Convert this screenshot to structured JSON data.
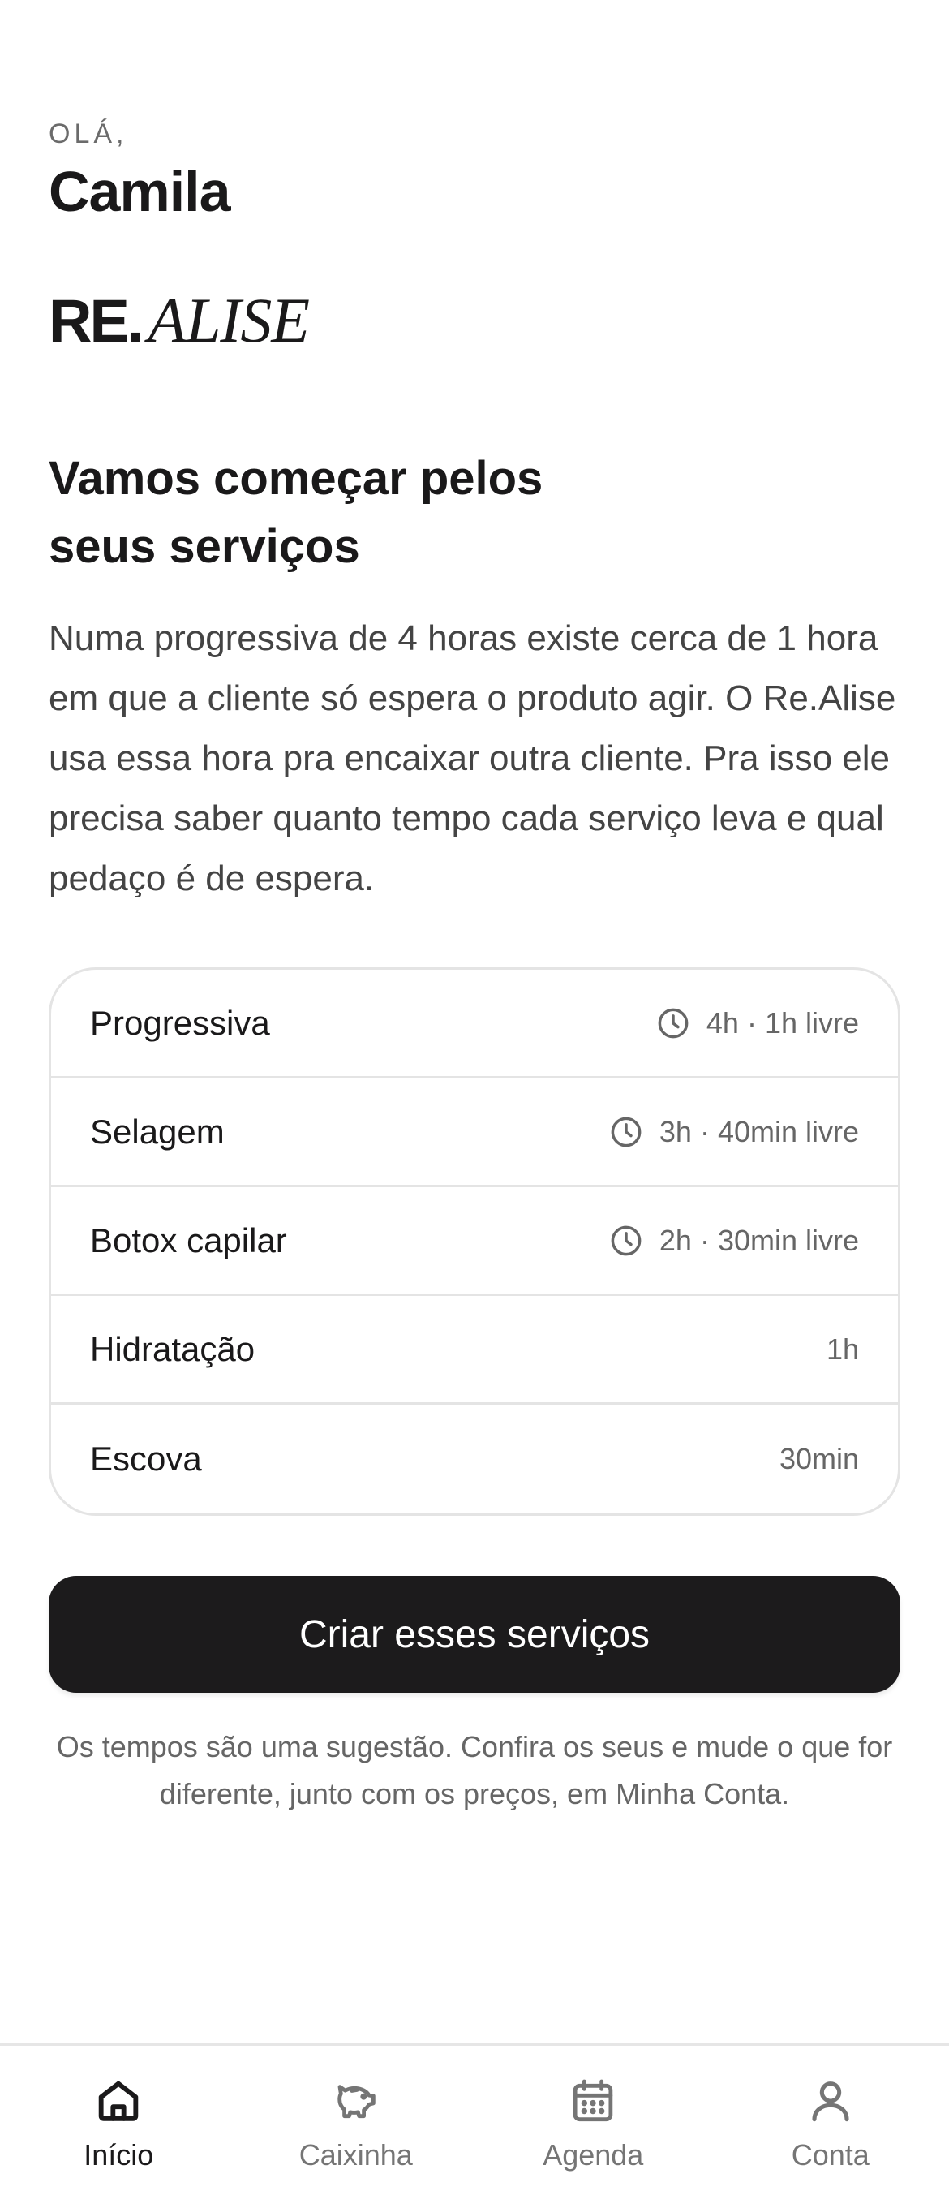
{
  "greeting": {
    "label": "OLÁ,",
    "name": "Camila"
  },
  "brand": {
    "logo_bold": "RE.",
    "logo_italic": "ALISE"
  },
  "intro": {
    "title": "Vamos começar pelos seus serviços",
    "description": "Numa progressiva de 4 horas existe cerca de 1 hora em que a cliente só espera o produto agir. O Re.Alise usa essa hora pra encaixar outra cliente. Pra isso ele precisa saber quanto tempo cada serviço leva e qual pedaço é de espera."
  },
  "services": [
    {
      "name": "Progressiva",
      "duration": "4h · 1h livre",
      "icon": "clock-icon"
    },
    {
      "name": "Selagem",
      "duration": "3h · 40min livre",
      "icon": "clock-icon"
    },
    {
      "name": "Botox capilar",
      "duration": "2h · 30min livre",
      "icon": "clock-icon"
    },
    {
      "name": "Hidratação",
      "duration": "1h",
      "icon": ""
    },
    {
      "name": "Escova",
      "duration": "30min",
      "icon": ""
    }
  ],
  "cta": {
    "label": "Criar esses serviços"
  },
  "footnote": "Os tempos são uma sugestão. Confira os seus e mude o que for diferente, junto com os preços, em Minha Conta.",
  "nav": {
    "items": [
      {
        "label": "Início",
        "icon": "home-icon",
        "active": true
      },
      {
        "label": "Caixinha",
        "icon": "piggy-bank-icon",
        "active": false
      },
      {
        "label": "Agenda",
        "icon": "calendar-icon",
        "active": false
      },
      {
        "label": "Conta",
        "icon": "user-icon",
        "active": false
      }
    ]
  },
  "colors": {
    "primary": "#1c1b1c",
    "text_muted": "#666666",
    "border": "#e4e4e4",
    "background": "#ffffff"
  }
}
